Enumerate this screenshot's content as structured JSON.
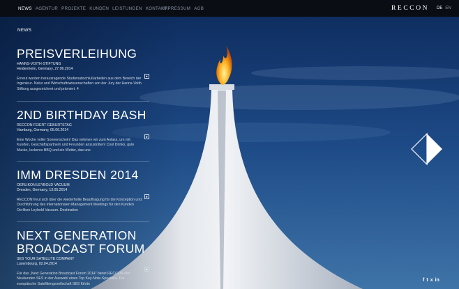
{
  "nav": {
    "items": [
      "NEWS",
      "AGENTUR",
      "PROJEKTE",
      "KUNDEN",
      "LEISTUNGEN",
      "KONTAKT"
    ],
    "active": "NEWS",
    "secondary": [
      "IMPRESSUM",
      "AGB"
    ]
  },
  "logo": "RECCON",
  "lang": {
    "de": "DE",
    "en": "EN"
  },
  "section_label": "NEWS",
  "news": [
    {
      "title": "PREISVERLEIHUNG",
      "company": "HANNS-VOITH-STIFTUNG",
      "location_date": "Heidenheim, Germany, 27.06.2014",
      "text": "Erneut wurden herausragende Studienabschlußarbeiten aus dem Bereich der Ingenieur- Natur und Wirtschaftswissenschaften von der Jury der Hanns-Voith Stiftung ausgezeichnet und prämiert. 4"
    },
    {
      "title": "2ND BIRTHDAY BASH",
      "company": "RECCON FEIERT GEBURTSTAG",
      "location_date": "Hamburg, Germany, 05.06.2014",
      "text": "Eine Woche voller Sonnenschein! Das nehmen wir zum Anlass, um mit Kunden, Geschäftspartnern und Freunden anzustoßen! Cool Drinks, gute Mucke, leckeres BBQ und ein Wetter, das uns"
    },
    {
      "title": "IMM DRESDEN 2014",
      "company": "OERLIKON LEYBOLD VACUUM",
      "location_date": "Dresden, Germany, 13.05.2014",
      "text": "RECCON freut sich über die wiederholte Beauftragung für die Konzeption und Durchführung des internationalen Management Meetings für den Kunden Oerlikon Leybold Vacuum. Destination"
    },
    {
      "title": "NEXT GENERATION BROADCAST FORUM",
      "company": "SES YOUR SATELLITE COMPANY",
      "location_date": "Luxembourg, 02.04.2014",
      "text": "Für das „Next Generation Broadcast Forum 2014\" bietet RECCON den Neukunden SES in der Auswahl eines Top Key-Note-Speakers. Die europäische Satellitengesellschaft SES führte"
    }
  ],
  "more_label": "▸",
  "social": [
    "f",
    "t",
    "x",
    "in"
  ],
  "colors": {
    "topbar": "#0a0d14",
    "sky_top": "#0f2f63",
    "sky_bottom": "#2b5a92"
  }
}
